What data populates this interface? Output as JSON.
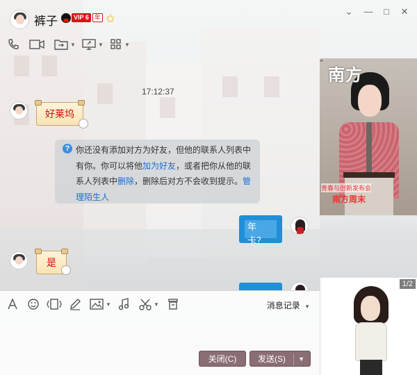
{
  "window": {
    "contact_name": "裤子",
    "vip_label": "VIP 6",
    "vip_year": "年",
    "controls": {
      "expand": "⌄",
      "minimize": "—",
      "maximize": "□",
      "close": "✕"
    }
  },
  "toolbar": {
    "items": [
      "voice-call",
      "video-call",
      "send-file",
      "remote-desktop",
      "apps"
    ]
  },
  "chat": {
    "timestamp": "17:12:37",
    "messages": [
      {
        "from": "contact",
        "text": "好莱坞"
      },
      {
        "from": "system",
        "parts": {
          "p1": "你还没有添加对方为好友，但他的联系人列表中有你。你可以将他",
          "link_add": "加为好友",
          "p2": "，或者把你从他的联系人列表中",
          "link_delete": "删除",
          "p3": "，删除后对方不会收到提示。",
          "link_manage": "管理陌生人"
        }
      },
      {
        "from": "self",
        "text": "年卡？"
      },
      {
        "from": "contact",
        "text": "是"
      }
    ]
  },
  "ad_panel": {
    "masthead": "南方",
    "caption_small": "青春与创新发布会",
    "caption_large": "南方周末"
  },
  "show_panel": {
    "pager": "1/2"
  },
  "input": {
    "message_log_label": "消息记录",
    "close_button": "关闭(C)",
    "send_button": "发送(S)"
  },
  "colors": {
    "vip_red": "#d9141b",
    "link_blue": "#1b6fc8",
    "self_bubble": "#1f8fd8",
    "button_bg": "#8a6e74"
  }
}
